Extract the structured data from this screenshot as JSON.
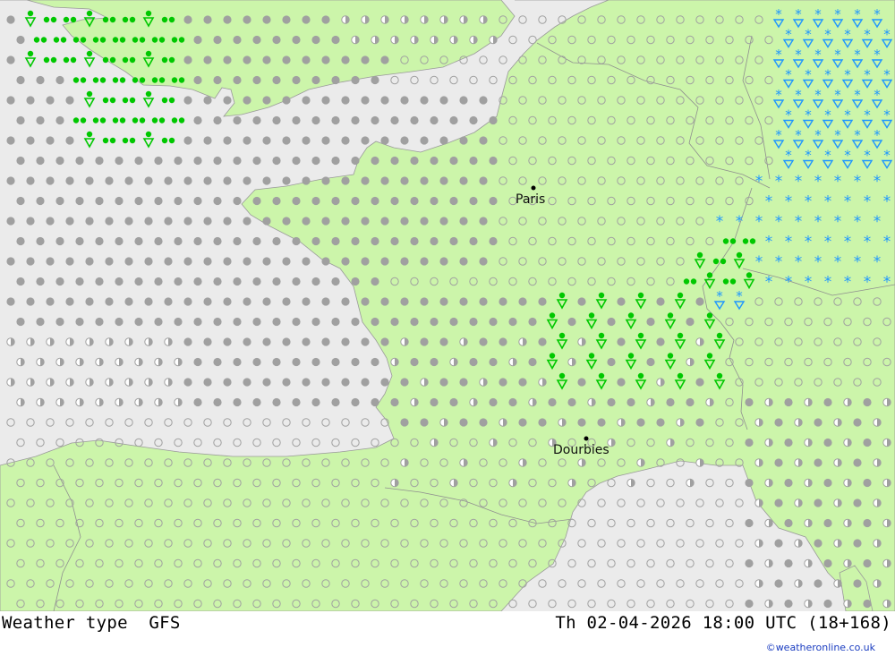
{
  "map": {
    "colors": {
      "sea": "#ebebeb",
      "land": "#ccf5aa",
      "border": "#9a9a9a",
      "cloud": "#a0a0a0",
      "rain": "#00c800",
      "snow": "#1e96ff"
    },
    "cities": [
      {
        "name": "Paris"
      },
      {
        "name": "Dourbies"
      }
    ],
    "legend_symbols": [
      "clear-icon",
      "partly-cloudy-icon",
      "overcast-icon",
      "rain-icon",
      "shower-icon",
      "snow-icon",
      "snow-shower-icon"
    ]
  },
  "footer": {
    "left_label": "Weather type  GFS",
    "right_label": "Th 02-04-2026 18:00 UTC (18+168)",
    "credit": "©weatheronline.co.uk"
  }
}
